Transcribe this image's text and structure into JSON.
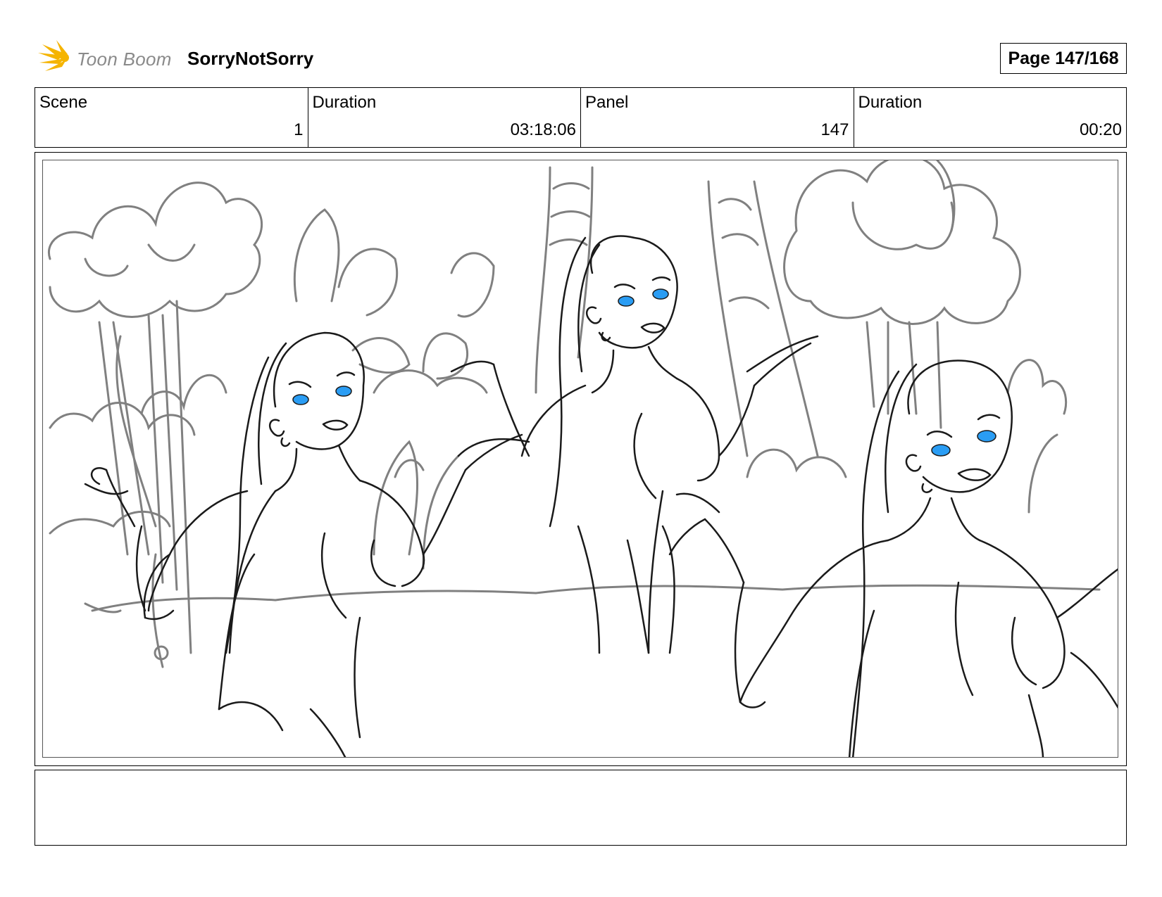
{
  "header": {
    "logo_text": "Toon Boom",
    "project_title": "SorryNotSorry",
    "page_label": "Page 147/168"
  },
  "info": {
    "scene_label": "Scene",
    "scene_value": "1",
    "scene_duration_label": "Duration",
    "scene_duration_value": "03:18:06",
    "panel_label": "Panel",
    "panel_value": "147",
    "panel_duration_label": "Duration",
    "panel_duration_value": "00:20"
  },
  "panel": {
    "line_color": "#1a1a1a",
    "background_line_color": "#808080",
    "eye_color": "#2a9df4"
  },
  "notes": {
    "text": ""
  },
  "colors": {
    "logo_yellow": "#f5b400",
    "logo_text_gray": "#8a8a8a"
  }
}
